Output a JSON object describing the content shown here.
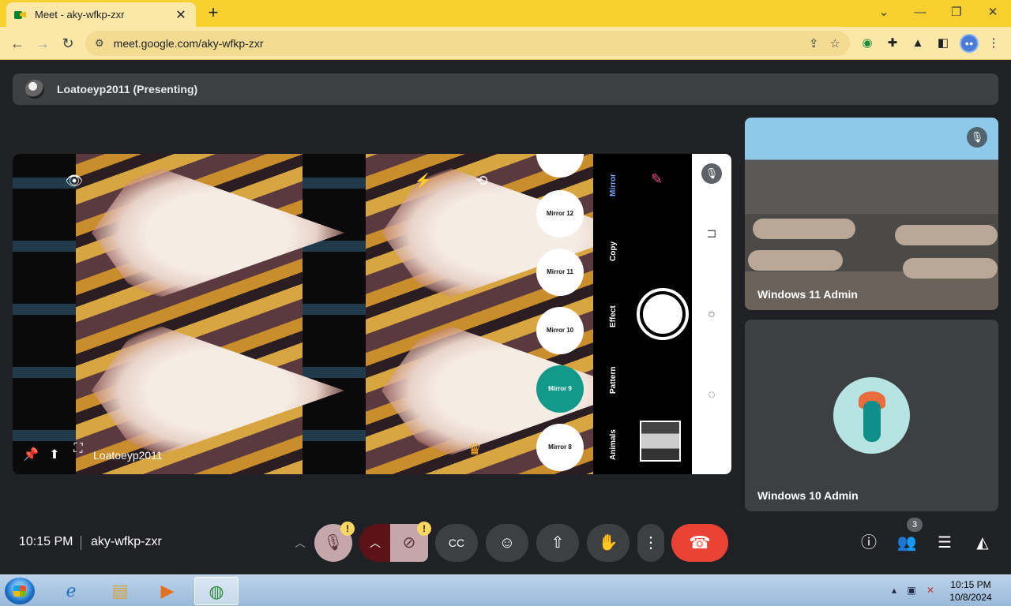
{
  "browser": {
    "tab_title": "Meet - aky-wfkp-zxr",
    "tab_close": "✕",
    "new_tab": "+",
    "url": "meet.google.com/aky-wfkp-zxr",
    "window_controls": {
      "collapse": "⌄",
      "minimize": "—",
      "restore": "❐",
      "close": "✕"
    },
    "nav": {
      "back": "←",
      "forward": "→",
      "reload": "↻"
    }
  },
  "meet": {
    "presenting_label": "Loatoeyp2011 (Presenting)",
    "stage_name": "Loatoeyp2011",
    "mirror_modes": [
      "Mirror 12",
      "Mirror 11",
      "Mirror 10",
      "Mirror 9",
      "Mirror 8"
    ],
    "active_mirror_mode": "Mirror 9",
    "categories": [
      "Mirror",
      "Copy",
      "Effect",
      "Pattern",
      "Animals"
    ],
    "active_category": "Mirror",
    "participants": [
      {
        "name": "Windows 11 Admin",
        "muted": true
      },
      {
        "name": "Windows 10 Admin",
        "muted": false
      }
    ],
    "time": "10:15 PM",
    "meeting_code": "aky-wfkp-zxr",
    "people_count": "3",
    "warning_glyph": "!"
  },
  "taskbar": {
    "time": "10:15 PM",
    "date": "10/8/2024"
  },
  "colors": {
    "title_bar": "#f7cf2f",
    "end_call": "#ea4335",
    "active_mode": "#13998a",
    "meet_background": "#202124"
  }
}
